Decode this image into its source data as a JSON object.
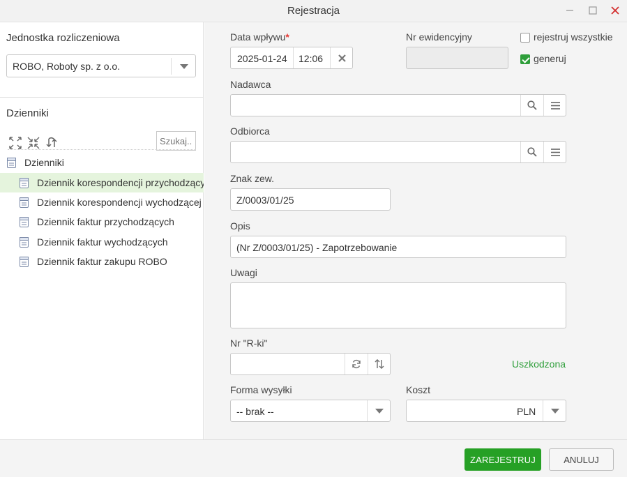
{
  "window": {
    "title": "Rejestracja"
  },
  "left": {
    "unit_title": "Jednostka rozliczeniowa",
    "unit_value": "ROBO, Roboty sp. z o.o.",
    "journals_title": "Dzienniki",
    "search_placeholder": "Szukaj..",
    "tree": {
      "root": "Dzienniki",
      "items": [
        {
          "label": "Dziennik korespondencji przychodzących",
          "selected": true
        },
        {
          "label": "Dziennik korespondencji wychodzącej",
          "selected": false
        },
        {
          "label": "Dziennik faktur przychodzących",
          "selected": false
        },
        {
          "label": "Dziennik faktur wychodzących",
          "selected": false
        },
        {
          "label": "Dziennik faktur zakupu ROBO",
          "selected": false
        }
      ]
    }
  },
  "form": {
    "date_label": "Data wpływu",
    "date_value": "2025-01-24",
    "time_value": "12:06",
    "nr_ewid_label": "Nr ewidencyjny",
    "nr_ewid_value": "",
    "register_all_label": "rejestruj wszystkie",
    "register_all_checked": false,
    "generate_label": "generuj",
    "generate_checked": true,
    "sender_label": "Nadawca",
    "sender_value": "",
    "recipient_label": "Odbiorca",
    "recipient_value": "",
    "ext_sign_label": "Znak zew.",
    "ext_sign_value": "Z/0003/01/25",
    "desc_label": "Opis",
    "desc_value": "(Nr Z/0003/01/25) - Zapotrzebowanie",
    "notes_label": "Uwagi",
    "notes_value": "",
    "rki_label": "Nr \"R-ki\"",
    "rki_value": "",
    "damaged_label": "Uszkodzona",
    "shipping_label": "Forma wysyłki",
    "shipping_value": "-- brak --",
    "cost_label": "Koszt",
    "cost_value": "",
    "currency": "PLN"
  },
  "footer": {
    "register_button": "ZAREJESTRUJ",
    "cancel_button": "ANULUJ"
  },
  "colors": {
    "accent_green": "#26a025",
    "required_red": "#e53935",
    "selected_row": "#e5f4dd"
  }
}
